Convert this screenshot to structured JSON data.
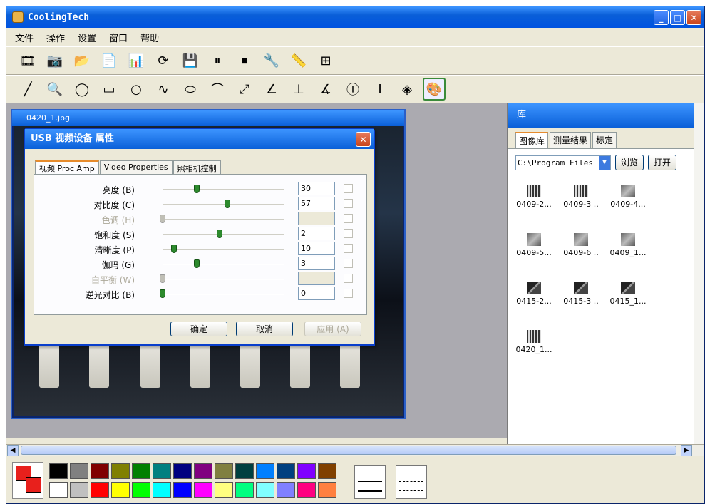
{
  "app": {
    "title": "CoolingTech"
  },
  "window_buttons": {
    "minimize": "_",
    "maximize": "□",
    "close": "✕"
  },
  "menu": [
    "文件",
    "操作",
    "设置",
    "窗口",
    "帮助"
  ],
  "toolbar1": [
    "video-icon",
    "camera-icon",
    "open-folder-icon",
    "word-icon",
    "excel-icon",
    "refresh-icon",
    "save-icon",
    "pause-icon",
    "stop-icon",
    "settings-icon",
    "ruler-icon",
    "scale-icon"
  ],
  "toolbar2": [
    "line-tool",
    "magnifier-tool",
    "circle-select-tool",
    "rectangle-tool",
    "circle-tool",
    "curve-tool",
    "ellipse-tool",
    "arc-tool",
    "point-distance-tool",
    "angle-tool",
    "perpendicular-tool",
    "angle-measure-tool",
    "circle-count-tool",
    "text-tool",
    "diamond-tool",
    "palette-tool"
  ],
  "image_window": {
    "title": "0420_1.jpg"
  },
  "dialog": {
    "title": "USB 视频设备 属性",
    "tabs": [
      "视频 Proc Amp",
      "Video Properties",
      "照相机控制"
    ],
    "rows": [
      {
        "label": "亮度 (B)",
        "value": "30",
        "level": 0.3,
        "enabled": true
      },
      {
        "label": "对比度 (C)",
        "value": "57",
        "level": 0.57,
        "enabled": true
      },
      {
        "label": "色调 (H)",
        "value": "",
        "level": 0.0,
        "enabled": false
      },
      {
        "label": "饱和度 (S)",
        "value": "2",
        "level": 0.5,
        "enabled": true
      },
      {
        "label": "清晰度 (P)",
        "value": "10",
        "level": 0.1,
        "enabled": true
      },
      {
        "label": "伽玛 (G)",
        "value": "3",
        "level": 0.3,
        "enabled": true
      },
      {
        "label": "白平衡 (W)",
        "value": "",
        "level": 0.0,
        "enabled": false
      },
      {
        "label": "逆光对比 (B)",
        "value": "0",
        "level": 0.0,
        "enabled": true
      }
    ],
    "buttons": {
      "ok": "确定",
      "cancel": "取消",
      "apply": "应用 (A)"
    }
  },
  "library": {
    "title": "库",
    "tabs": [
      "图像库",
      "测量结果",
      "标定"
    ],
    "path": "C:\\Program Files",
    "browse": "浏览",
    "open": "打开",
    "thumbnails": [
      {
        "name": "0409-2...",
        "style": "stripes"
      },
      {
        "name": "0409-3 ..",
        "style": "stripes"
      },
      {
        "name": "0409-4...",
        "style": "gray"
      },
      {
        "name": "0409-5...",
        "style": "gray"
      },
      {
        "name": "0409-6 ..",
        "style": "gray"
      },
      {
        "name": "0409_1...",
        "style": "gray"
      },
      {
        "name": "0415-2...",
        "style": "diag"
      },
      {
        "name": "0415-3 ..",
        "style": "diag"
      },
      {
        "name": "0415_1...",
        "style": "diag"
      },
      {
        "name": "0420_1...",
        "style": "stripes"
      }
    ]
  },
  "palette": {
    "current": "#e8201c",
    "colors": [
      "#000000",
      "#808080",
      "#800000",
      "#808000",
      "#008000",
      "#008080",
      "#000080",
      "#800080",
      "#808040",
      "#004040",
      "#0080ff",
      "#004080",
      "#8000ff",
      "#804000",
      "#ffffff",
      "#c0c0c0",
      "#ff0000",
      "#ffff00",
      "#00ff00",
      "#00ffff",
      "#0000ff",
      "#ff00ff",
      "#ffff80",
      "#00ff80",
      "#80ffff",
      "#8080ff",
      "#ff0080",
      "#ff8040"
    ]
  }
}
